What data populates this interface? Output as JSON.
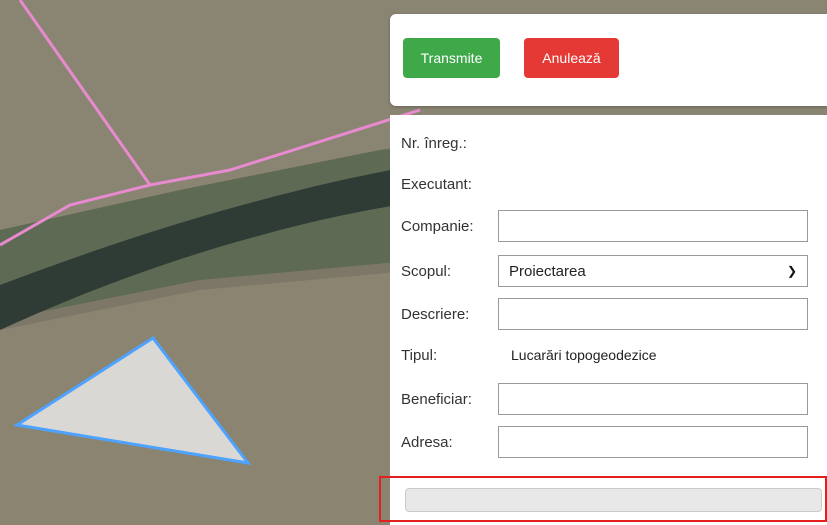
{
  "toolbar": {
    "submit_label": "Transmite",
    "cancel_label": "Anulează"
  },
  "form": {
    "nr_label": "Nr. înreg.:",
    "executant_label": "Executant:",
    "companie_label": "Companie:",
    "companie_value": "",
    "scopul_label": "Scopul:",
    "scopul_value": "Proiectarea",
    "descriere_label": "Descriere:",
    "descriere_value": "",
    "tipul_label": "Tipul:",
    "tipul_value": "Lucarări topogeodezice",
    "beneficiar_label": "Beneficiar:",
    "beneficiar_value": "",
    "adresa_label": "Adresa:",
    "adresa_value": ""
  },
  "progress": {
    "value": 0
  },
  "map": {
    "polygon_color": "#4da3ff",
    "boundary_color": "#e88ad0"
  }
}
